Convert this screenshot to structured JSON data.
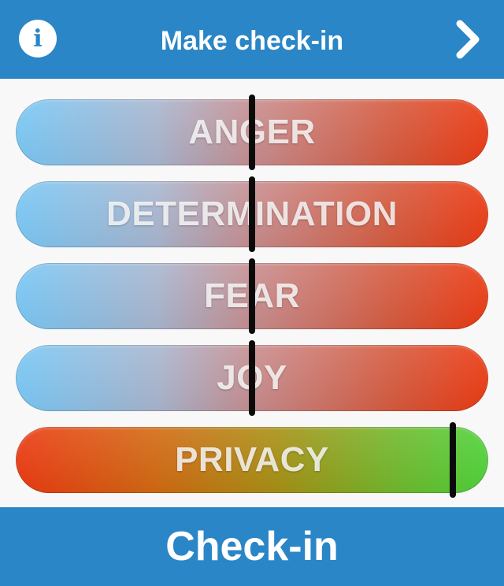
{
  "header": {
    "title": "Make check-in",
    "info_icon": "info-icon",
    "info_glyph": "i",
    "next_icon": "chevron-right-icon"
  },
  "sliders": [
    {
      "label": "ANGER",
      "value": 0.5,
      "kind": "emotion"
    },
    {
      "label": "DETERMINATION",
      "value": 0.5,
      "kind": "emotion"
    },
    {
      "label": "FEAR",
      "value": 0.5,
      "kind": "emotion"
    },
    {
      "label": "JOY",
      "value": 0.5,
      "kind": "emotion"
    },
    {
      "label": "PRIVACY",
      "value": 0.925,
      "kind": "privacy"
    }
  ],
  "colors": {
    "bar": "#2a86c6",
    "emotion_low": "#79c8f6",
    "emotion_high": "#ec3a12",
    "privacy_low": "#ec3a12",
    "privacy_high": "#4ed33a"
  },
  "footer": {
    "button_label": "Check-in"
  }
}
